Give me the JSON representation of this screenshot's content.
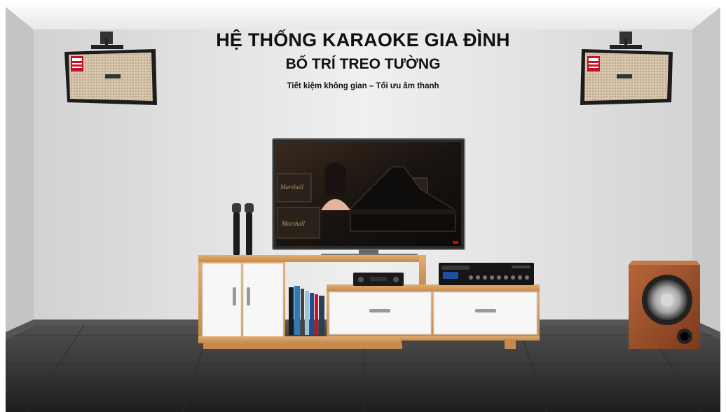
{
  "headline": {
    "title": "HỆ THỐNG KARAOKE GIA ĐÌNH",
    "subtitle": "BỐ TRÍ TREO TƯỜNG",
    "tagline": "Tiết kiệm không gian – Tối ưu âm thanh"
  },
  "tv_screen": {
    "amp_logo": "Marshall"
  },
  "colors": {
    "wall": "#dedede",
    "floor": "#3a3a3a",
    "wood": "#d39a5c",
    "cabinet_white": "#f7f7f7",
    "subwoofer_wood": "#a0522d"
  }
}
